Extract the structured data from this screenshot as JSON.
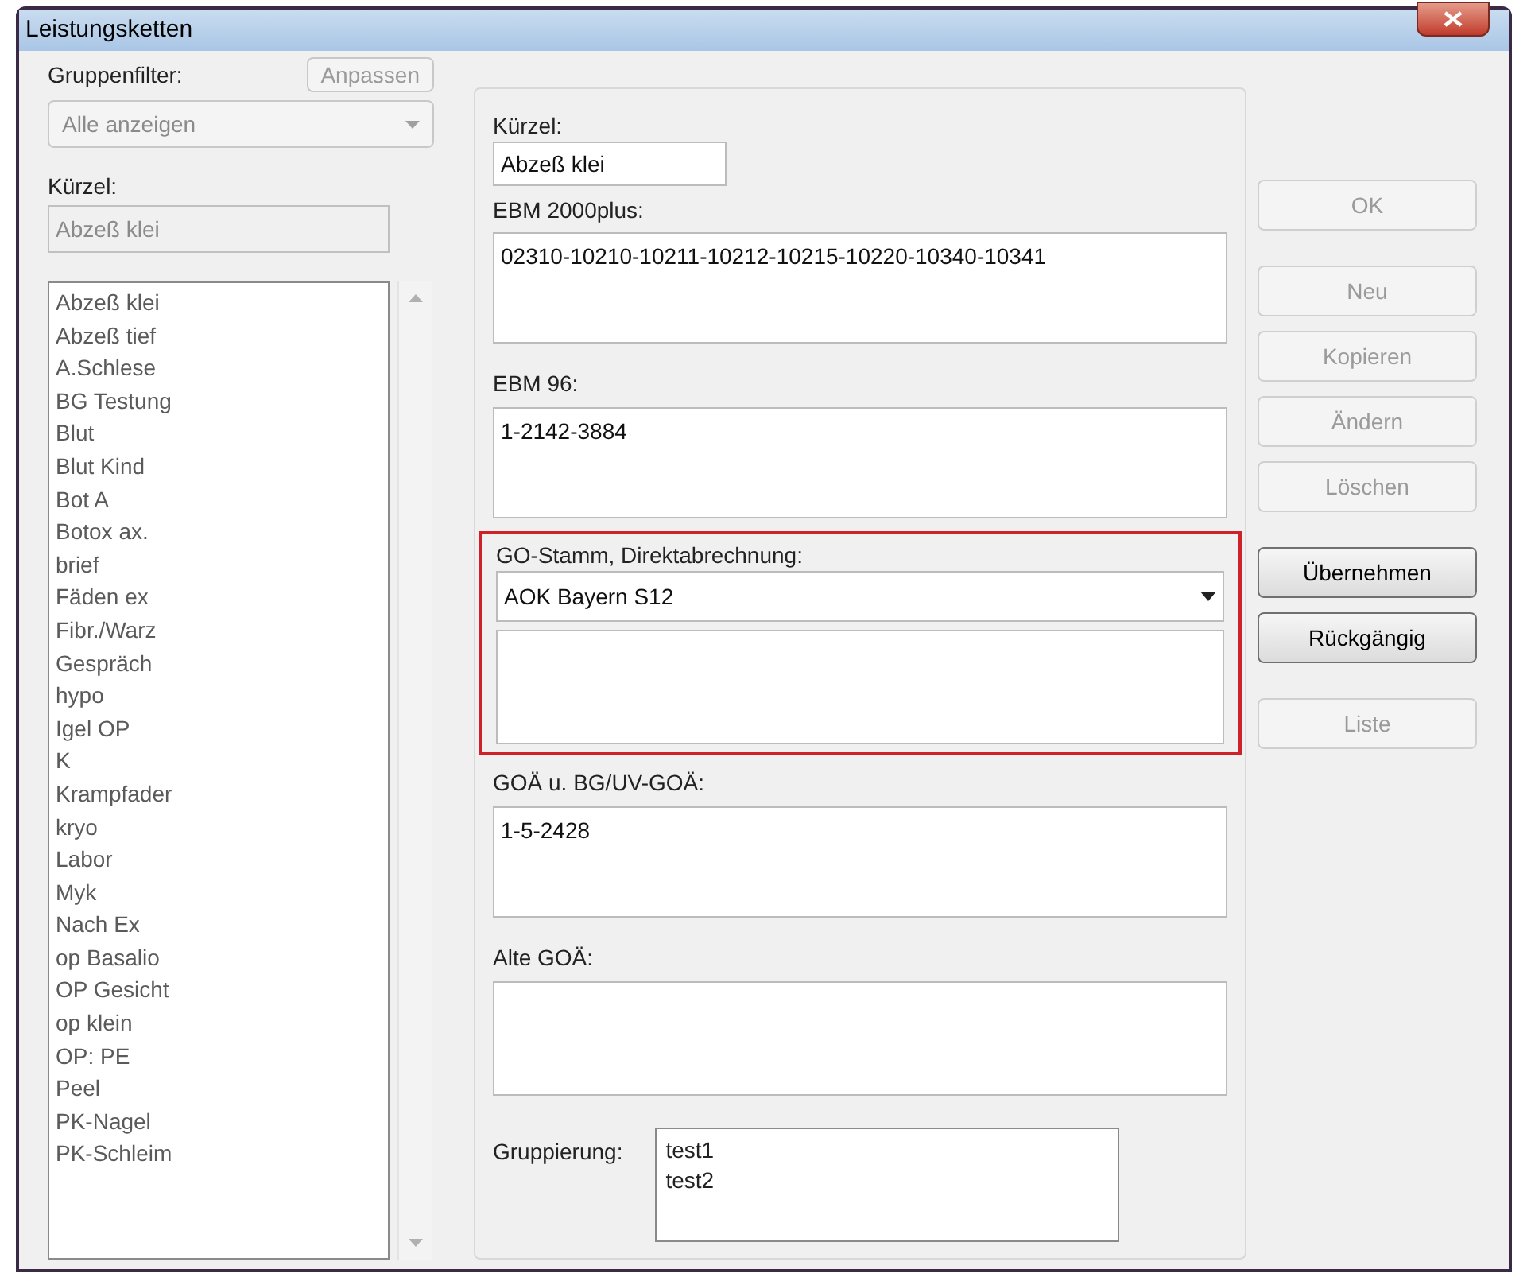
{
  "window": {
    "title": "Leistungsketten"
  },
  "left": {
    "group_filter_label": "Gruppenfilter:",
    "adjust_button": {
      "label": "Anpassen",
      "disabled": true
    },
    "group_filter": {
      "value": "Alle anzeigen",
      "disabled": true
    },
    "kuerzel_label": "Kürzel:",
    "kuerzel_field": {
      "value": "Abzeß klei",
      "disabled": true
    },
    "list": [
      {
        "label": "Abzeß klei"
      },
      {
        "label": "Abzeß tief"
      },
      {
        "label": "A.Schlese"
      },
      {
        "label": "BG Testung"
      },
      {
        "label": "Blut"
      },
      {
        "label": "Blut Kind"
      },
      {
        "label": "Bot A"
      },
      {
        "label": "Botox ax."
      },
      {
        "label": "brief"
      },
      {
        "label": "Fäden ex"
      },
      {
        "label": "Fibr./Warz"
      },
      {
        "label": "Gespräch"
      },
      {
        "label": "hypo"
      },
      {
        "label": "Igel OP"
      },
      {
        "label": "K"
      },
      {
        "label": "Krampfader"
      },
      {
        "label": "kryo"
      },
      {
        "label": "Labor"
      },
      {
        "label": "Myk"
      },
      {
        "label": "Nach Ex"
      },
      {
        "label": "op Basalio"
      },
      {
        "label": "OP Gesicht"
      },
      {
        "label": "op klein"
      },
      {
        "label": "OP: PE"
      },
      {
        "label": "Peel"
      },
      {
        "label": "PK-Nagel"
      },
      {
        "label": "PK-Schleim"
      }
    ]
  },
  "form": {
    "kuerzel": {
      "label": "Kürzel:",
      "value": "Abzeß klei"
    },
    "ebm2000": {
      "label": "EBM 2000plus:",
      "value": "02310-10210-10211-10212-10215-10220-10340-10341"
    },
    "ebm96": {
      "label": "EBM 96:",
      "value": "1-2142-3884"
    },
    "go_stamm": {
      "label": "GO-Stamm, Direktabrechnung:",
      "value": "AOK Bayern S12",
      "highlighted": true
    },
    "goae": {
      "label": "GOÄ u. BG/UV-GOÄ:",
      "value": "1-5-2428"
    },
    "alte_goae": {
      "label": "Alte GOÄ:"
    },
    "gruppierung": {
      "label": "Gruppierung:",
      "items": [
        "test1",
        "test2"
      ]
    }
  },
  "button_groups": [
    [
      {
        "label": "OK",
        "disabled": true
      }
    ],
    [
      {
        "label": "Neu",
        "disabled": true
      },
      {
        "label": "Kopieren",
        "disabled": true
      },
      {
        "label": "Ändern",
        "disabled": true
      },
      {
        "label": "Löschen",
        "disabled": true
      }
    ],
    [
      {
        "label": "Übernehmen",
        "disabled": false
      },
      {
        "label": "Rückgängig",
        "disabled": false
      }
    ],
    [
      {
        "label": "Liste",
        "disabled": true
      }
    ]
  ]
}
